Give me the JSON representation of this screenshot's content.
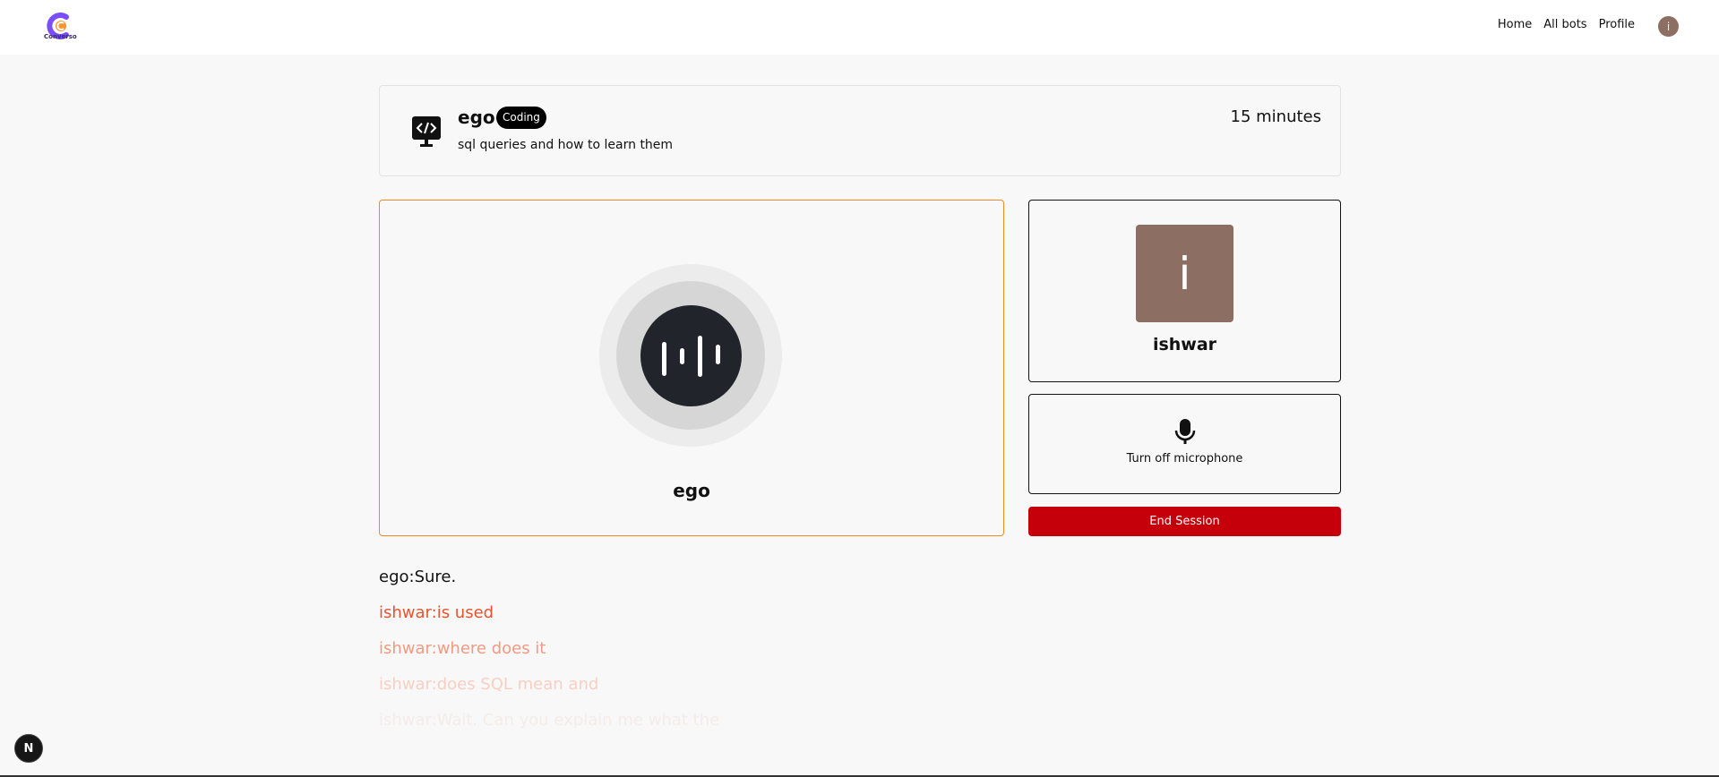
{
  "nav": {
    "logo_text": "Converso",
    "links": [
      "Home",
      "All bots",
      "Profile"
    ],
    "avatar_initial": "i"
  },
  "session": {
    "bot_name": "ego",
    "category_badge": "Coding",
    "topic": "sql queries and how to learn them",
    "duration": "15 minutes",
    "topic_icon": "code-monitor-icon"
  },
  "bot_panel": {
    "name": "ego",
    "icon": "soundwave-icon",
    "accent_color": "#f08a24"
  },
  "user_panel": {
    "avatar_initial": "i",
    "name": "ishwar",
    "avatar_color": "#8d6e63"
  },
  "mic": {
    "label": "Turn off microphone",
    "icon": "microphone-icon"
  },
  "end_session": {
    "label": "End Session",
    "color": "#c5000b"
  },
  "transcript": [
    {
      "text": "ego:Sure."
    },
    {
      "text": "ishwar:is used"
    },
    {
      "text": "ishwar:where does it"
    },
    {
      "text": "ishwar:does SQL mean and"
    },
    {
      "text": "ishwar:Wait. Can you explain me what the"
    }
  ],
  "dev_badge": "N"
}
